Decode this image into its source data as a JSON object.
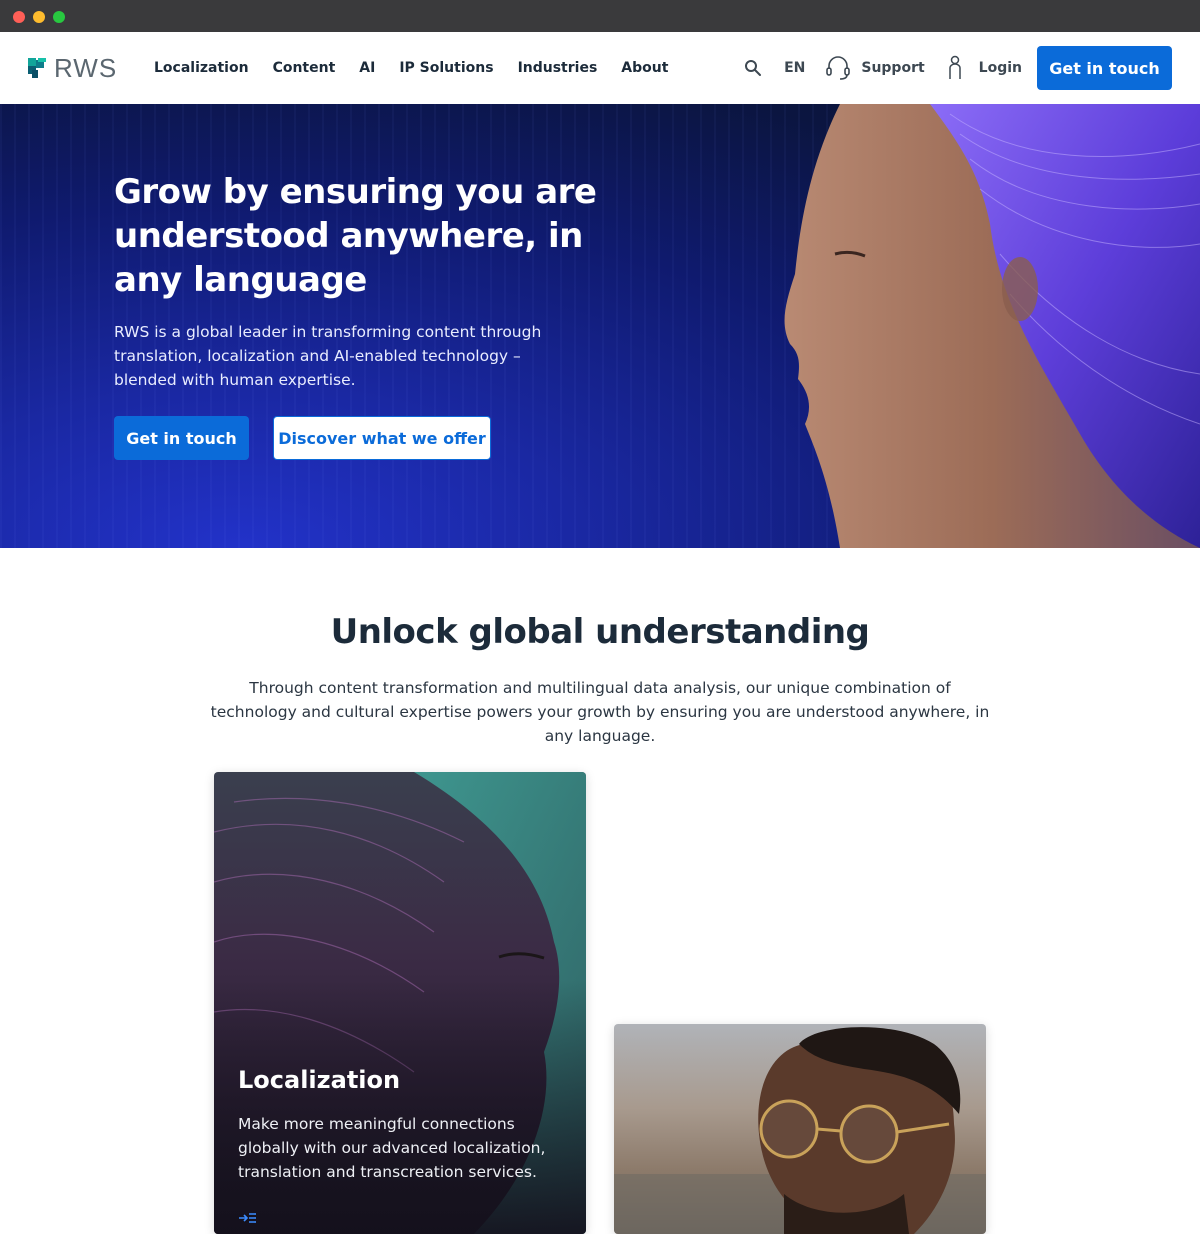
{
  "header": {
    "logo_text": "RWS",
    "nav": [
      "Localization",
      "Content",
      "AI",
      "IP Solutions",
      "Industries",
      "About"
    ],
    "language": "EN",
    "support_label": "Support",
    "login_label": "Login",
    "cta_label": "Get in touch"
  },
  "hero": {
    "title": "Grow by ensuring you are understood anywhere, in any language",
    "subtitle": "RWS is a global leader in transforming content through translation, localization and AI-enabled technology – blended with human expertise.",
    "primary_button": "Get in touch",
    "secondary_button": "Discover what we offer"
  },
  "section": {
    "title": "Unlock global understanding",
    "subtitle": "Through content transformation and multilingual data analysis, our unique combination of technology and cultural expertise powers your growth by ensuring you are understood anywhere, in any language."
  },
  "cards": [
    {
      "title": "Localization",
      "text": "Make more meaningful connections globally with our advanced localization, translation and transcreation services."
    }
  ],
  "colors": {
    "accent": "#0b6bd9",
    "hero_dark": "#0b1540",
    "logo_teal": "#12a59a"
  }
}
